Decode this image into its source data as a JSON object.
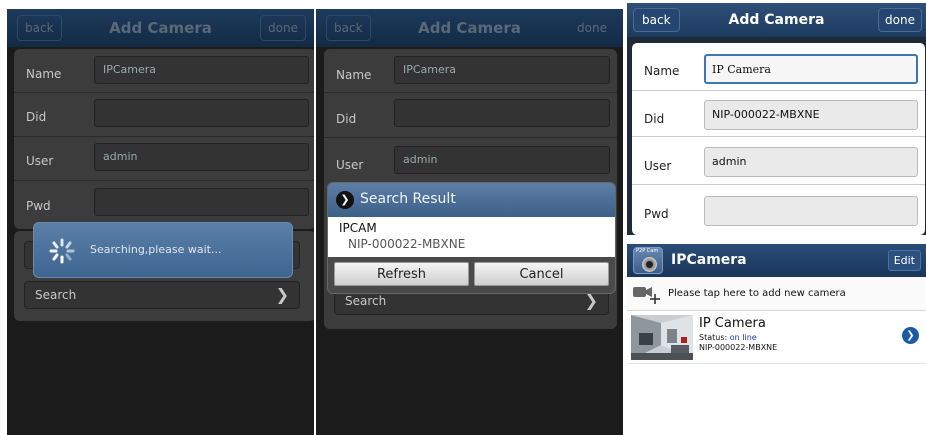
{
  "screen1": {
    "back": "back",
    "title": "Add Camera",
    "done": "done",
    "fields": [
      {
        "label": "Name",
        "value": "IPCamera"
      },
      {
        "label": "Did",
        "value": ""
      },
      {
        "label": "User",
        "value": "admin"
      },
      {
        "label": "Pwd",
        "value": ""
      }
    ],
    "search_label": "Search",
    "toast": "Searching,please wait..."
  },
  "screen2": {
    "back": "back",
    "title": "Add Camera",
    "done": "done",
    "fields": [
      {
        "label": "Name",
        "value": "IPCamera"
      },
      {
        "label": "Did",
        "value": ""
      },
      {
        "label": "User",
        "value": "admin"
      }
    ],
    "search_label": "Search",
    "dialog": {
      "title": "Search Result",
      "result_name": "IPCAM",
      "result_id": "NIP-000022-MBXNE",
      "refresh": "Refresh",
      "cancel": "Cancel"
    }
  },
  "screen3": {
    "back": "back",
    "title": "Add Camera",
    "done": "done",
    "fields": [
      {
        "label": "Name",
        "value": "IP Camera"
      },
      {
        "label": "Did",
        "value": "NIP-000022-MBXNE"
      },
      {
        "label": "User",
        "value": "admin"
      },
      {
        "label": "Pwd",
        "value": ""
      }
    ]
  },
  "screen4": {
    "app_icon_text": "P2P Cam",
    "title": "IPCamera",
    "edit": "Edit",
    "add_hint": "Please tap here to add new camera",
    "camera": {
      "name": "IP Camera",
      "status_label": "Status:",
      "status_value": "on line",
      "id": "NIP-000022-MBXNE"
    }
  },
  "colors": {
    "status_online": "#1a3aa0",
    "accent_blue": "#1c5aa6"
  }
}
